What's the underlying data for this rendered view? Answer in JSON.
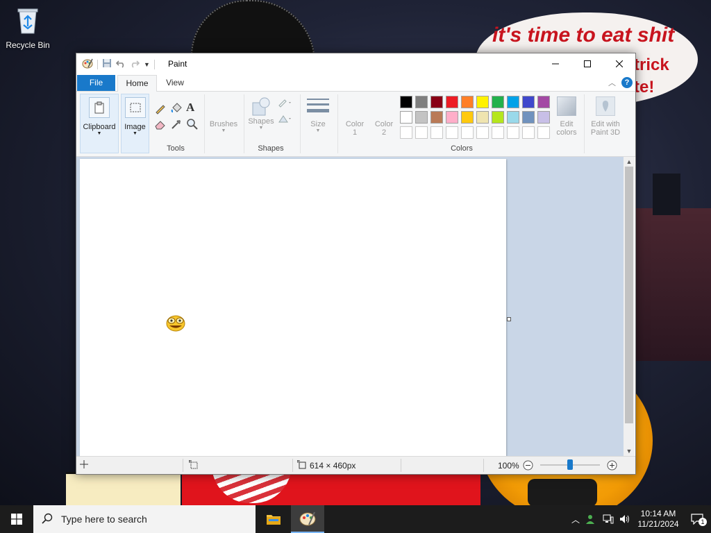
{
  "desktop": {
    "recycle_bin_label": "Recycle Bin",
    "wallpaper_text": {
      "line1": "it's time to eat shit",
      "line2": "trick",
      "line3": "te!"
    }
  },
  "window": {
    "title": "Paint",
    "tabs": [
      {
        "label": "File"
      },
      {
        "label": "Home"
      },
      {
        "label": "View"
      }
    ],
    "ribbon": {
      "clipboard_label": "Clipboard",
      "image_label": "Image",
      "tools_group_label": "Tools",
      "brushes_label": "Brushes",
      "shapes_label": "Shapes",
      "shapes_group_label": "Shapes",
      "size_label": "Size",
      "color1_label": "Color",
      "color1_num": "1",
      "color2_label": "Color",
      "color2_num": "2",
      "edit_colors_label1": "Edit",
      "edit_colors_label2": "colors",
      "paint3d_label1": "Edit with",
      "paint3d_label2": "Paint 3D",
      "colors_group_label": "Colors"
    },
    "palette": {
      "row1": [
        "#000000",
        "#7f7f7f",
        "#880015",
        "#ed1c24",
        "#ff7f27",
        "#fff200",
        "#22b14c",
        "#00a2e8",
        "#3f48cc",
        "#a349a4"
      ],
      "row2": [
        "#ffffff",
        "#c3c3c3",
        "#b97a57",
        "#ffaec9",
        "#ffc90e",
        "#efe4b0",
        "#b5e61d",
        "#99d9ea",
        "#7092be",
        "#c8bfe7"
      ],
      "row3_empty_count": 10
    },
    "status": {
      "image_size": "614 × 460px",
      "zoom": "100%"
    }
  },
  "taskbar": {
    "search_placeholder": "Type here to search",
    "time": "10:14 AM",
    "date": "11/21/2024",
    "notification_count": "1"
  }
}
